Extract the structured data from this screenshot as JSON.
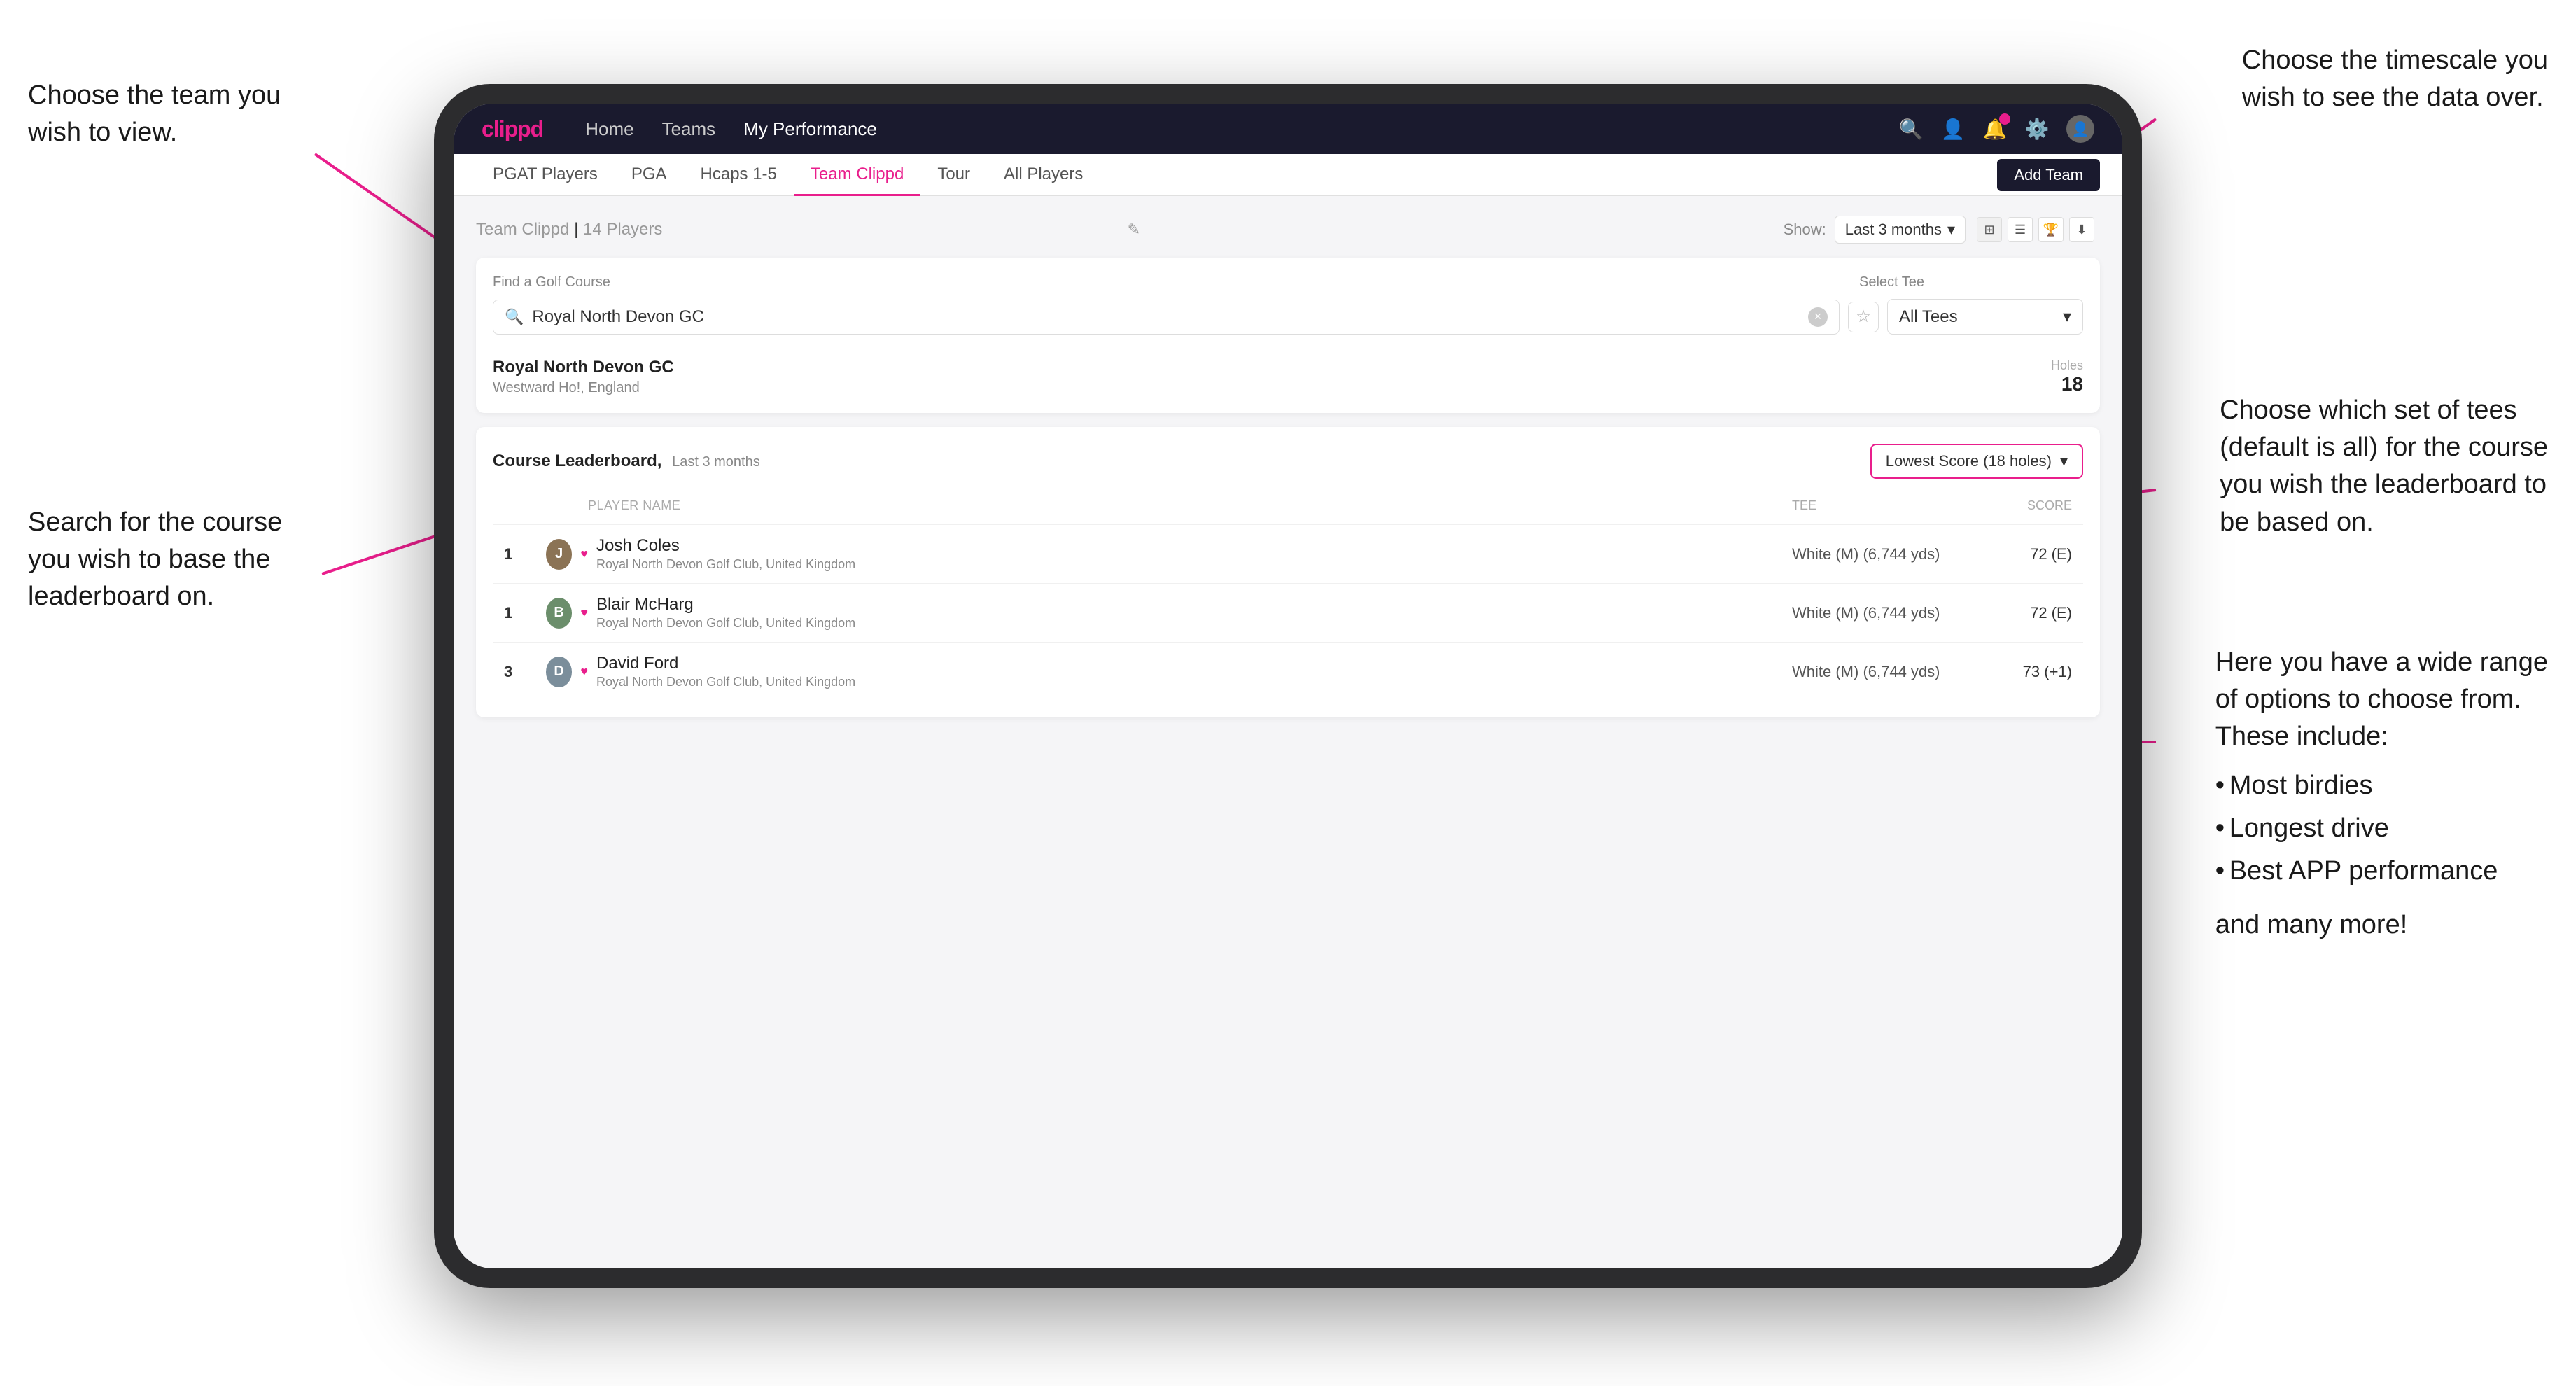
{
  "annotations": {
    "top_left_title": "Choose the team you\nwish to view.",
    "top_right_title": "Choose the timescale you\nwish to see the data over.",
    "middle_left_title": "Search for the course\nyou wish to base the\nleaderboard on.",
    "right_tees_title": "Choose which set of tees\n(default is all) for the course\nyou wish the leaderboard to\nbe based on.",
    "right_options_title": "Here you have a wide range\nof options to choose from.\nThese include:",
    "bullet1": "Most birdies",
    "bullet2": "Longest drive",
    "bullet3": "Best APP performance",
    "and_more": "and many more!"
  },
  "navbar": {
    "logo": "clippd",
    "links": [
      "Home",
      "Teams",
      "My Performance"
    ],
    "active_link": "My Performance"
  },
  "subnav": {
    "tabs": [
      "PGAT Players",
      "PGA",
      "Hcaps 1-5",
      "Team Clippd",
      "Tour",
      "All Players"
    ],
    "active_tab": "Team Clippd",
    "add_team_label": "Add Team"
  },
  "team_header": {
    "title": "Team Clippd",
    "player_count": "14 Players",
    "show_label": "Show:",
    "show_value": "Last 3 months"
  },
  "search": {
    "label": "Find a Golf Course",
    "placeholder": "Royal North Devon GC",
    "tee_label": "Select Tee",
    "tee_value": "All Tees"
  },
  "course_result": {
    "name": "Royal North Devon GC",
    "location": "Westward Ho!, England",
    "holes_label": "Holes",
    "holes": "18"
  },
  "leaderboard": {
    "title": "Course Leaderboard,",
    "subtitle": "Last 3 months",
    "score_option": "Lowest Score (18 holes)",
    "col_player": "PLAYER NAME",
    "col_tee": "TEE",
    "col_score": "SCORE",
    "players": [
      {
        "rank": "1",
        "name": "Josh Coles",
        "club": "Royal North Devon Golf Club, United Kingdom",
        "tee": "White (M) (6,744 yds)",
        "score": "72 (E)",
        "avatar_color": "#8B7355"
      },
      {
        "rank": "1",
        "name": "Blair McHarg",
        "club": "Royal North Devon Golf Club, United Kingdom",
        "tee": "White (M) (6,744 yds)",
        "score": "72 (E)",
        "avatar_color": "#6B8E6B"
      },
      {
        "rank": "3",
        "name": "David Ford",
        "club": "Royal North Devon Golf Club, United Kingdom",
        "tee": "White (M) (6,744 yds)",
        "score": "73 (+1)",
        "avatar_color": "#7B8E9B"
      }
    ]
  },
  "colors": {
    "brand_pink": "#e91e8c",
    "navbar_bg": "#1a1a2e",
    "active_tab_color": "#e91e8c"
  }
}
